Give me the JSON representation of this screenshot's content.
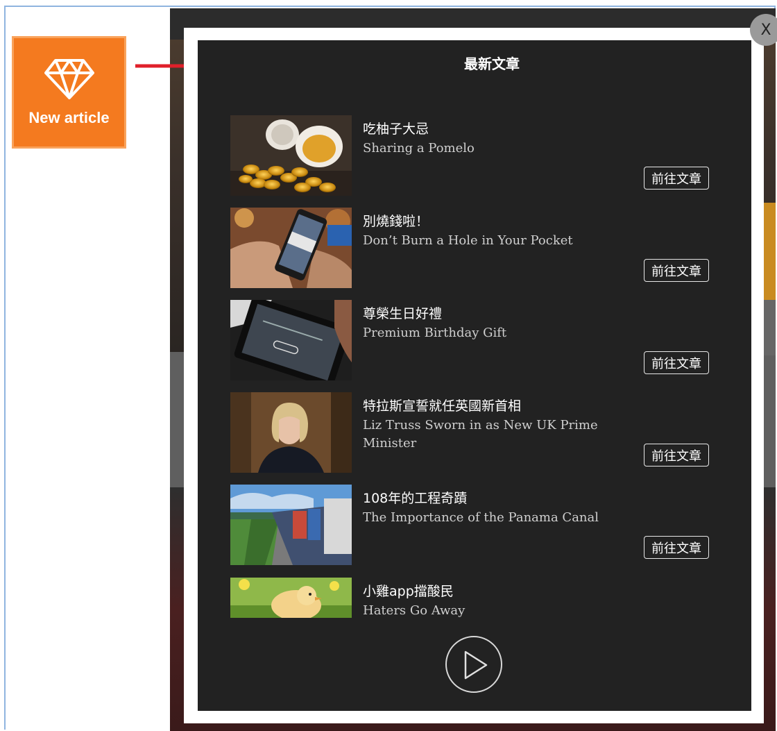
{
  "badge": {
    "label": "New article",
    "icon": "diamond-icon"
  },
  "modal": {
    "title": "最新文章",
    "close_label": "X",
    "go_label": "前往文章",
    "play_icon": "play-icon"
  },
  "articles": [
    {
      "title": "吃柚子大忌",
      "subtitle": "Sharing a Pomelo",
      "go": "前往文章"
    },
    {
      "title": "別燒錢啦！",
      "subtitle": "Don’t Burn a Hole in Your Pocket",
      "go": "前往文章"
    },
    {
      "title": "尊榮生日好禮",
      "subtitle": "Premium Birthday Gift",
      "go": "前往文章"
    },
    {
      "title": "特拉斯宣誓就任英國新首相",
      "subtitle": "Liz Truss Sworn in as New UK Prime Minister",
      "go": "前往文章"
    },
    {
      "title": "108年的工程奇蹟",
      "subtitle": "The Importance of the Panama Canal",
      "go": "前往文章"
    },
    {
      "title": "小雞app擋酸民",
      "subtitle": "Haters Go Away"
    }
  ],
  "colors": {
    "badge": "#f47a1f",
    "arrow": "#e0202a",
    "modal_bg": "#222222",
    "modal_border": "#ffffff"
  }
}
